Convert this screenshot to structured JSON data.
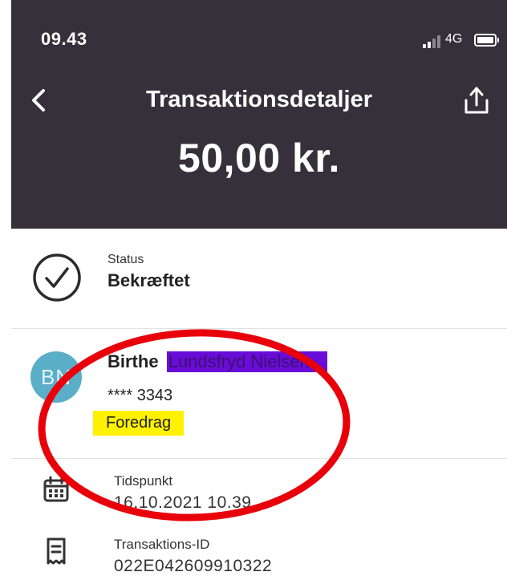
{
  "status_bar": {
    "time": "09.43",
    "network": "4G"
  },
  "header": {
    "title": "Transaktionsdetaljer",
    "amount": "50,00 kr."
  },
  "status": {
    "label": "Status",
    "value": "Bekræftet"
  },
  "recipient": {
    "initials": "BN",
    "first_name": "Birthe",
    "last_name_redacted": "Lundsfryd Nielsen",
    "account": "**** 3343",
    "message": "Foredrag"
  },
  "details": {
    "timestamp_label": "Tidspunkt",
    "timestamp_value": "16.10.2021 10.39",
    "transaction_id_label": "Transaktions-ID",
    "transaction_id_value": "022E042609910322"
  },
  "colors": {
    "header_bg": "#36303a",
    "avatar_bg": "#5aaec8",
    "redaction": "#6a0cd8",
    "highlight": "#fff200",
    "annotation": "#e8000b"
  },
  "icons": [
    "back-arrow-icon",
    "share-icon",
    "check-circle-icon",
    "calendar-icon",
    "receipt-icon",
    "signal-icon",
    "battery-icon"
  ]
}
